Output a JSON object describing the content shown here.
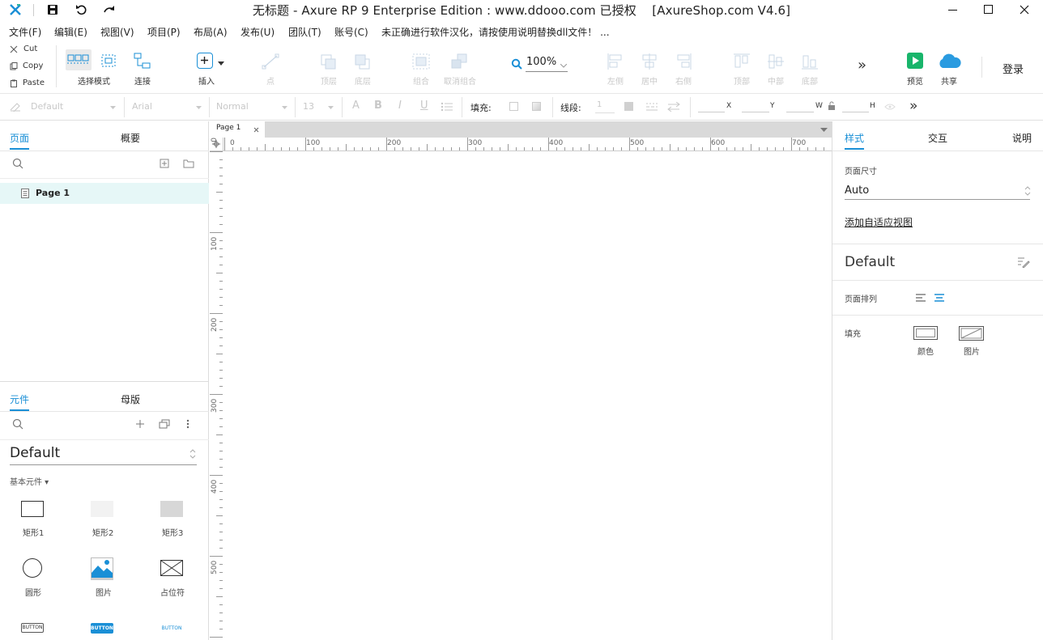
{
  "window": {
    "title": "无标题 - Axure RP 9 Enterprise Edition : www.ddooo.com 已授权    [AxureShop.com V4.6]"
  },
  "menu": [
    "文件(F)",
    "编辑(E)",
    "视图(V)",
    "项目(P)",
    "布局(A)",
    "发布(U)",
    "团队(T)",
    "账号(C)",
    "未正确进行软件汉化，请按使用说明替换dll文件！ ..."
  ],
  "clipboard": {
    "cut": "Cut",
    "copy": "Copy",
    "paste": "Paste"
  },
  "toolbar": {
    "select_mode": "选择模式",
    "connect": "连接",
    "insert": "插入",
    "point": "点",
    "top_layer": "顶层",
    "bottom_layer": "底层",
    "group": "组合",
    "ungroup": "取消组合",
    "zoom": "100%",
    "align_left": "左侧",
    "align_center": "居中",
    "align_right": "右侧",
    "align_top": "顶部",
    "align_middle": "中部",
    "align_bottom": "底部",
    "more": "»",
    "preview": "预览",
    "share": "共享",
    "login": "登录"
  },
  "format": {
    "style": "Default",
    "font": "Arial",
    "weight": "Normal",
    "size": "13",
    "fill_label": "填充:",
    "line_label": "线段:",
    "line_value": "1",
    "x": "X",
    "y": "Y",
    "w": "W",
    "h": "H"
  },
  "left": {
    "tab_pages": "页面",
    "tab_outline": "概要",
    "page_item": "Page 1",
    "tab_widgets": "元件",
    "tab_masters": "母版",
    "library": "Default",
    "category": "基本元件 ▾",
    "widgets": [
      {
        "label": "矩形1"
      },
      {
        "label": "矩形2"
      },
      {
        "label": "矩形3"
      },
      {
        "label": "圆形"
      },
      {
        "label": "图片"
      },
      {
        "label": "占位符"
      },
      {
        "label": "BUTTON"
      },
      {
        "label": "BUTTON"
      },
      {
        "label": "BUTTON"
      }
    ]
  },
  "canvas": {
    "tab": "Page 1",
    "ruler_h": [
      "0",
      "100",
      "200",
      "300",
      "400",
      "500",
      "600",
      "700"
    ],
    "ruler_v": [
      "0",
      "100",
      "200",
      "300",
      "400",
      "500"
    ]
  },
  "right": {
    "tab_style": "样式",
    "tab_interaction": "交互",
    "tab_notes": "说明",
    "page_size_label": "页面尺寸",
    "page_size_value": "Auto",
    "adaptive_link": "添加自适应视图",
    "style_name": "Default",
    "page_align_label": "页面排列",
    "fill_label": "填充",
    "fill_color": "颜色",
    "fill_image": "图片"
  },
  "colors": {
    "accent": "#1a8fd6",
    "selected_row": "#e6f7f7",
    "preview_green": "#19b56b",
    "share_blue": "#2a9be0"
  }
}
